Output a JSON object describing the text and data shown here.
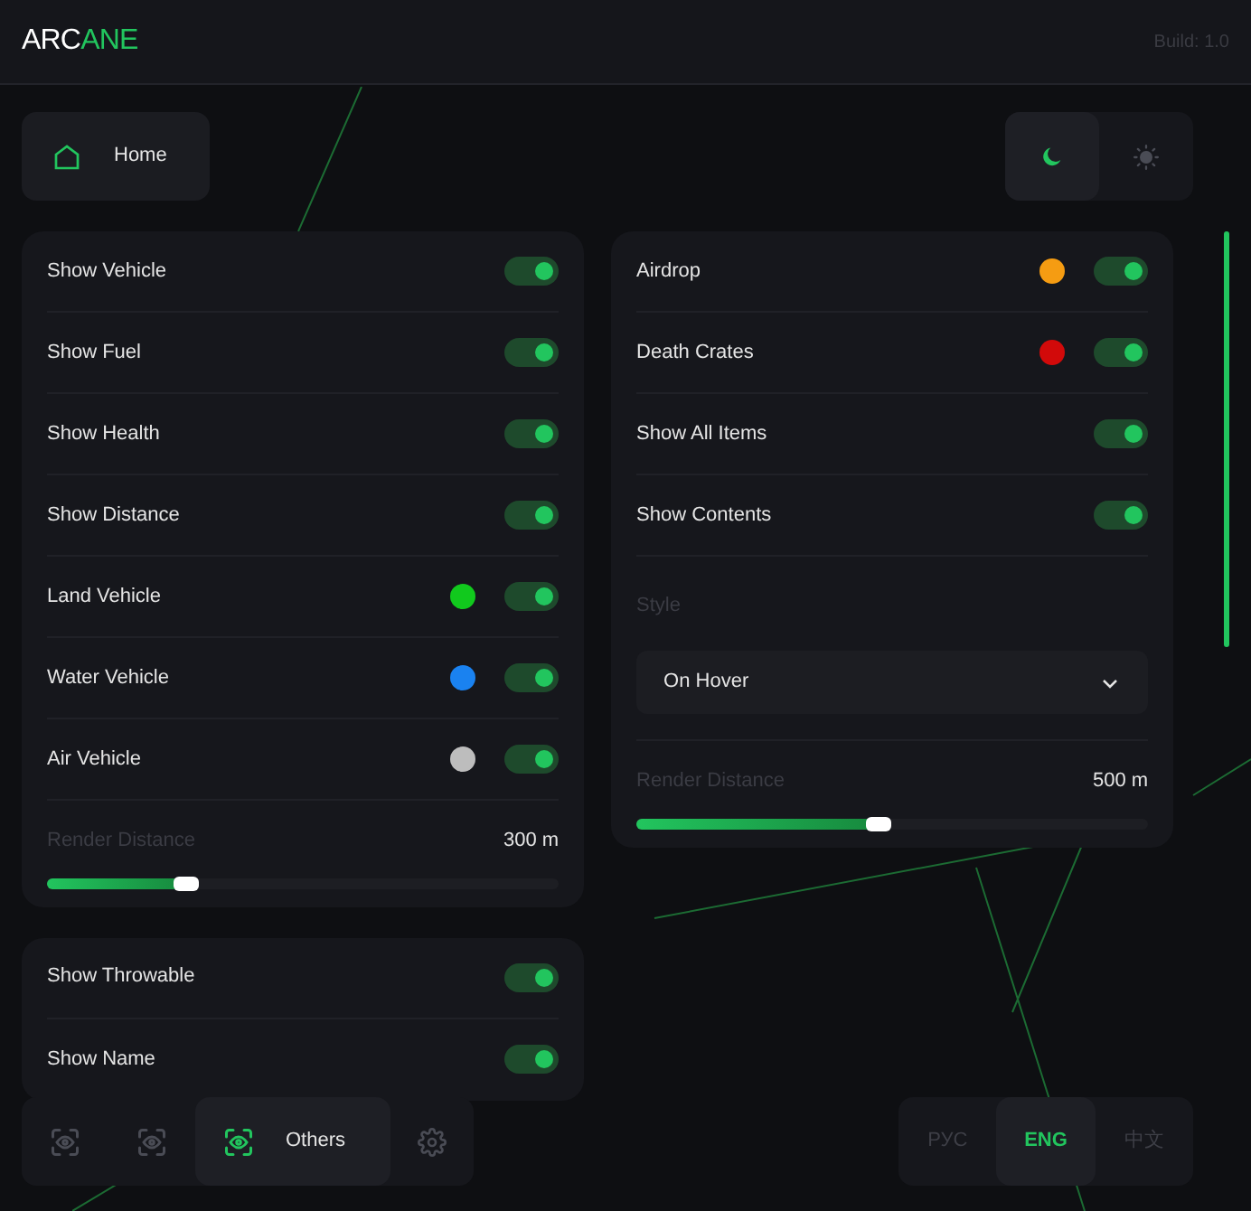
{
  "header": {
    "logo": {
      "first": "ARC",
      "second": "ANE"
    },
    "build": "Build: 1.0"
  },
  "home_button": {
    "label": "Home"
  },
  "theme_toggle": [
    {
      "kind": "moon",
      "selected": true
    },
    {
      "kind": "sun",
      "selected": false
    }
  ],
  "panels": [
    {
      "items": [
        {
          "kind": "toggle",
          "label": "Show Vehicle",
          "on": true
        },
        {
          "kind": "toggle",
          "label": "Show Fuel",
          "on": true
        },
        {
          "kind": "toggle",
          "label": "Show Health",
          "on": true
        },
        {
          "kind": "toggle",
          "label": "Show Distance",
          "on": true
        },
        {
          "kind": "toggle",
          "label": "Land Vehicle",
          "on": true,
          "color": "#11c91d"
        },
        {
          "kind": "toggle",
          "label": "Water Vehicle",
          "on": true,
          "color": "#1a82f0"
        },
        {
          "kind": "toggle",
          "label": "Air Vehicle",
          "on": true,
          "color": "#bdbdbd"
        },
        {
          "kind": "slider",
          "label": "Render Distance",
          "reading": "300 m",
          "level": 0.27
        }
      ]
    },
    {
      "items": [
        {
          "kind": "toggle",
          "label": "Airdrop",
          "on": true,
          "color": "#f59c12"
        },
        {
          "kind": "toggle",
          "label": "Death Crates",
          "on": true,
          "color": "#d20a0a"
        },
        {
          "kind": "toggle",
          "label": "Show All Items",
          "on": true
        },
        {
          "kind": "toggle",
          "label": "Show Contents",
          "on": true
        },
        {
          "kind": "select",
          "label": "Style",
          "value": "On Hover"
        },
        {
          "kind": "slider",
          "label": "Render Distance",
          "reading": "500 m",
          "level": 0.47
        }
      ]
    },
    {
      "items": [
        {
          "kind": "toggle",
          "label": "Show Throwable",
          "on": true
        },
        {
          "kind": "toggle",
          "label": "Show Name",
          "on": true
        }
      ]
    }
  ],
  "nav": [
    {
      "kind": "eye",
      "selected": false
    },
    {
      "kind": "eye",
      "selected": false
    },
    {
      "kind": "eye",
      "label": "Others",
      "selected": true
    },
    {
      "kind": "gear",
      "selected": false
    }
  ],
  "languages": [
    {
      "label": "РУС",
      "selected": false
    },
    {
      "label": "ENG",
      "selected": true
    },
    {
      "label": "中文",
      "selected": false
    }
  ]
}
